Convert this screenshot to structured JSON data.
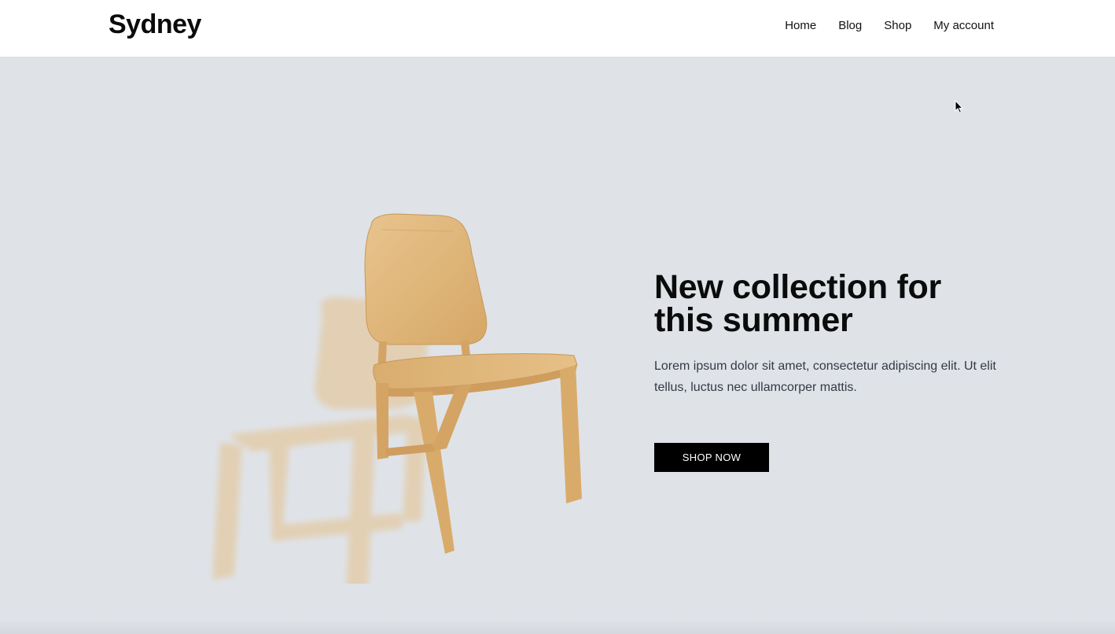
{
  "header": {
    "logo": "Sydney",
    "nav": [
      {
        "label": "Home"
      },
      {
        "label": "Blog"
      },
      {
        "label": "Shop"
      },
      {
        "label": "My account"
      }
    ]
  },
  "hero": {
    "title": "New collection for this summer",
    "text": "Lorem ipsum dolor sit amet, consectetur adipiscing elit. Ut elit tellus, luctus nec ullamcorper mattis.",
    "button_label": "SHOP NOW",
    "image": "wooden-chair-illustration"
  },
  "colors": {
    "hero_background": "#dfe3e8",
    "button_background": "#000000",
    "wood": "#e1b77c"
  }
}
